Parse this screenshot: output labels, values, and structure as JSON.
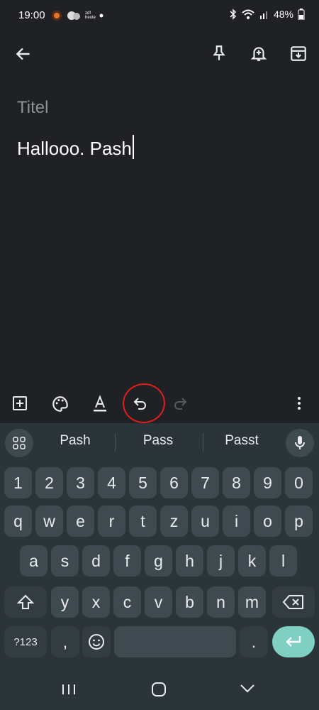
{
  "status_bar": {
    "time": "19:00",
    "notif_icons": [
      "fire-app-icon",
      "messaging-icon",
      "zdf-heute-icon",
      "dot-icon"
    ],
    "zdf_label": "zdf heute",
    "battery": "48%"
  },
  "note": {
    "title_placeholder": "Titel",
    "body": "Hallooo. Pash"
  },
  "suggestions": [
    "Pash",
    "Pass",
    "Passt"
  ],
  "keyboard": {
    "row_numbers": [
      "1",
      "2",
      "3",
      "4",
      "5",
      "6",
      "7",
      "8",
      "9",
      "0"
    ],
    "row1": [
      "q",
      "w",
      "e",
      "r",
      "t",
      "z",
      "u",
      "i",
      "o",
      "p"
    ],
    "row2": [
      "a",
      "s",
      "d",
      "f",
      "g",
      "h",
      "j",
      "k",
      "l"
    ],
    "row3": [
      "y",
      "x",
      "c",
      "v",
      "b",
      "n",
      "m"
    ],
    "symbols_label": "?123",
    "comma": ",",
    "period": "."
  },
  "colors": {
    "background": "#202124",
    "keyboard": "#2b3439",
    "key": "#3f4a50",
    "enter": "#7fd0c3",
    "annotation": "#e21d1d"
  }
}
